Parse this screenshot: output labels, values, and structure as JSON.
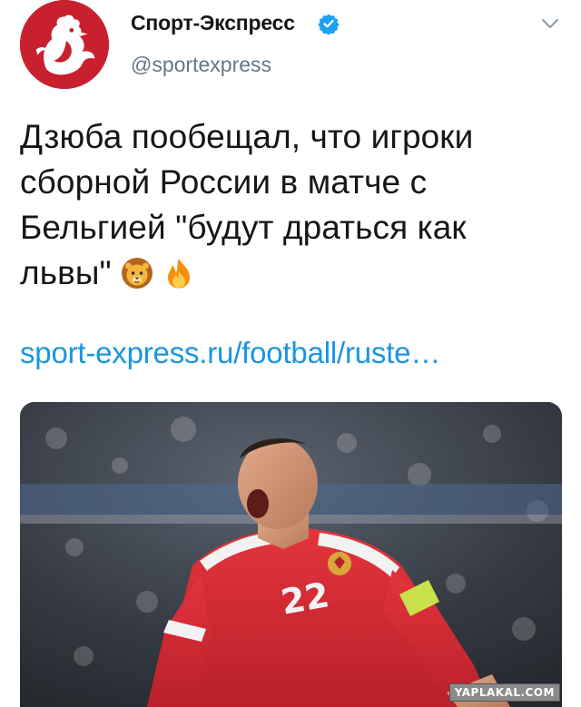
{
  "tweet": {
    "display_name": "Спорт-Экспресс",
    "handle": "@sportexpress",
    "text_lines": [
      "Дзюба пообещал, что игроки",
      "сборной России в матче с",
      "Бельгией \"будут драться как",
      "львы\""
    ],
    "emojis": [
      "lion-face-emoji",
      "fire-emoji"
    ],
    "link": "sport-express.ru/football/ruste…"
  },
  "media": {
    "jersey_number": "22",
    "watermark": "YAPLAKAL.COM"
  },
  "colors": {
    "brand_red": "#c8202e",
    "link_blue": "#1b95e0",
    "verified_blue": "#1da1f2",
    "handle_gray": "#657786"
  },
  "icons": {
    "verified": "verified-badge-icon",
    "menu": "chevron-down-icon"
  }
}
